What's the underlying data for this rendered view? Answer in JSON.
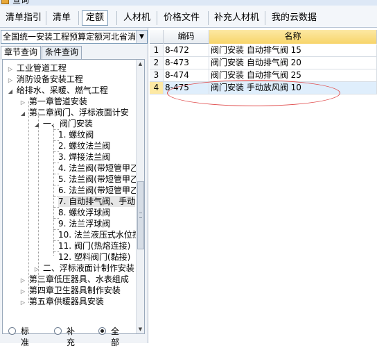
{
  "window": {
    "title": "查询"
  },
  "tabs": [
    {
      "label": "清单指引",
      "active": false
    },
    {
      "label": "清单",
      "active": false
    },
    {
      "label": "定额",
      "active": true
    },
    {
      "label": "人材机",
      "active": false
    },
    {
      "label": "价格文件",
      "active": false
    },
    {
      "label": "补充人材机",
      "active": false
    },
    {
      "label": "我的云数据",
      "active": false
    }
  ],
  "left": {
    "dropdown_value": "全国统一安装工程预算定额河北省消",
    "subtabs": [
      {
        "label": "章节查询",
        "active": true
      },
      {
        "label": "条件查询",
        "active": false
      }
    ],
    "tree": [
      {
        "label": "工业管道工程",
        "level": 0,
        "expander": "collapsed"
      },
      {
        "label": "消防设备安装工程",
        "level": 0,
        "expander": "collapsed"
      },
      {
        "label": "给排水、采暖、燃气工程",
        "level": 0,
        "expander": "expanded"
      },
      {
        "label": "第一章管道安装",
        "level": 1,
        "expander": "collapsed"
      },
      {
        "label": "第二章阀门、浮标液面计安",
        "level": 1,
        "expander": "expanded"
      },
      {
        "label": "一、阀门安装",
        "level": 2,
        "expander": "expanded"
      },
      {
        "label": "1. 螺纹阀",
        "level": 3
      },
      {
        "label": "2. 螺纹法兰阀",
        "level": 3
      },
      {
        "label": "3. 焊接法兰阀",
        "level": 3
      },
      {
        "label": "4. 法兰阀(带短管甲乙",
        "level": 3
      },
      {
        "label": "5. 法兰阀(带短管甲乙",
        "level": 3
      },
      {
        "label": "6. 法兰阀(带短管甲乙",
        "level": 3
      },
      {
        "label": "7. 自动排气阀、手动",
        "level": 3,
        "selected": true
      },
      {
        "label": "8. 螺纹浮球阀",
        "level": 3
      },
      {
        "label": "9. 法兰浮球阀",
        "level": 3
      },
      {
        "label": "10. 法兰液压式水位控",
        "level": 3
      },
      {
        "label": "11. 阀门(热熔连接)",
        "level": 3
      },
      {
        "label": "12. 塑料阀门(黏接)",
        "level": 3
      },
      {
        "label": "二、浮标液面计制作安装",
        "level": 2,
        "expander": "collapsed"
      },
      {
        "label": "第三章低压器具、水表组成",
        "level": 1,
        "expander": "collapsed"
      },
      {
        "label": "第四章卫生器具制作安装",
        "level": 1,
        "expander": "collapsed"
      },
      {
        "label": "第五章供暖器具安装",
        "level": 1,
        "expander": "collapsed"
      }
    ],
    "radios": [
      {
        "label": "标准",
        "checked": false
      },
      {
        "label": "补充",
        "checked": false
      },
      {
        "label": "全部",
        "checked": true
      }
    ]
  },
  "grid": {
    "columns": [
      "",
      "编码",
      "名称"
    ],
    "rows": [
      {
        "num": "1",
        "code": "8-472",
        "name": "阀门安装 自动排气阀 15",
        "selected": false
      },
      {
        "num": "2",
        "code": "8-473",
        "name": "阀门安装 自动排气阀 20",
        "selected": false
      },
      {
        "num": "3",
        "code": "8-474",
        "name": "阀门安装 自动排气阀 25",
        "selected": false
      },
      {
        "num": "4",
        "code": "8-475",
        "name": "阀门安装 手动放风阀 10",
        "selected": true
      }
    ]
  },
  "colors": {
    "annotation": "#e04a4a",
    "selected_row": "#dfeefc",
    "header_highlight": "#f7d46a"
  }
}
